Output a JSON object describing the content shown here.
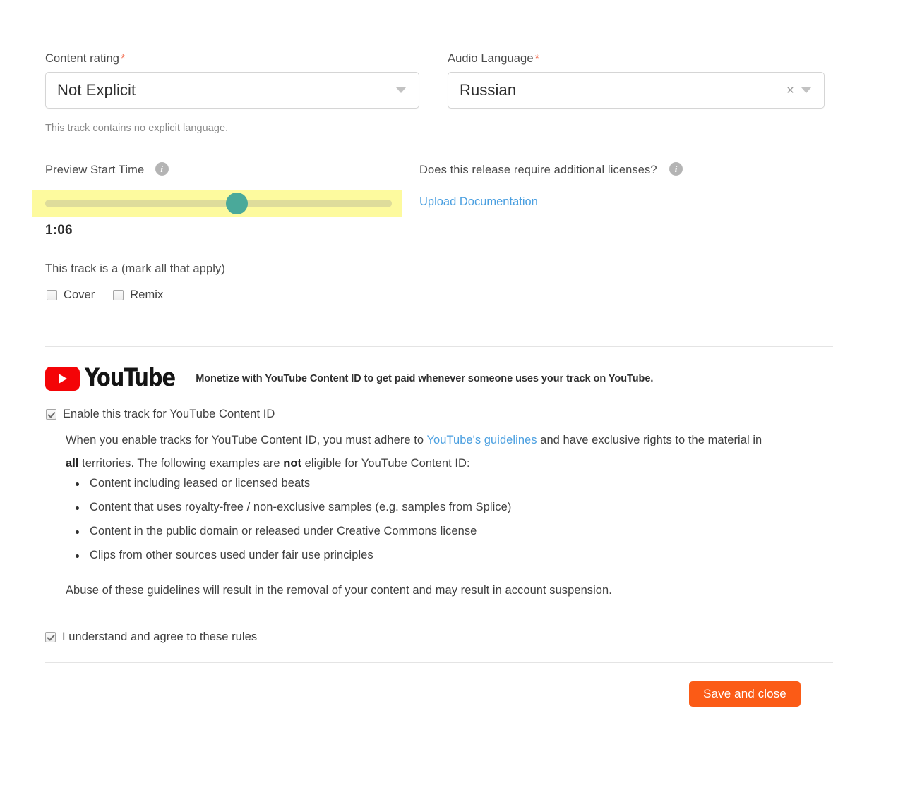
{
  "form": {
    "content_rating": {
      "label": "Content rating",
      "required_marker": "*",
      "value": "Not Explicit",
      "help": "This track contains no explicit language."
    },
    "audio_language": {
      "label": "Audio Language",
      "required_marker": "*",
      "value": "Russian",
      "clear_glyph": "×"
    },
    "preview_start_time": {
      "label": "Preview Start Time",
      "value_display": "1:06",
      "slider_percent": 56
    },
    "additional_licenses": {
      "label": "Does this release require additional licenses?",
      "upload_link": "Upload Documentation"
    },
    "track_type": {
      "label": "This track is a  (mark all that apply)",
      "options": [
        {
          "label": "Cover",
          "checked": false
        },
        {
          "label": "Remix",
          "checked": false
        }
      ]
    }
  },
  "youtube": {
    "wordmark": "YouTube",
    "tagline": "Monetize with YouTube Content ID to get paid whenever someone uses your track on YouTube.",
    "enable": {
      "label": "Enable this track for YouTube Content ID",
      "checked": true
    },
    "paragraph": {
      "part1": "When you enable tracks for YouTube Content ID, you must adhere to ",
      "link": "YouTube's guidelines",
      "part2": " and have exclusive rights to the material in ",
      "bold1": "all",
      "part3": " territories. The following examples are ",
      "bold2": "not",
      "part4": " eligible for YouTube Content ID:"
    },
    "bullets": [
      "Content including leased or licensed beats",
      "Content that uses royalty-free / non-exclusive samples (e.g. samples from Splice)",
      "Content in the public domain or released under Creative Commons license",
      "Clips from other sources used under fair use principles"
    ],
    "abuse_notice": "Abuse of these guidelines will result in the removal of your content and may result in account suspension.",
    "agree": {
      "label": "I understand and agree to these rules",
      "checked": true
    }
  },
  "footer": {
    "save_label": "Save and close"
  },
  "colors": {
    "accent_orange": "#fb5b16",
    "link_blue": "#4a9fe0",
    "required_red": "#f26c4f",
    "slider_thumb_teal": "#4aa99a",
    "slider_track": "#dedc9b",
    "highlight_yellow": "#fdfa9e",
    "youtube_red": "#f40407"
  }
}
